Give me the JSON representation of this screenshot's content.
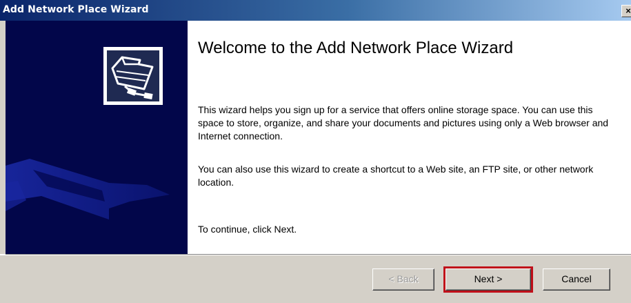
{
  "window": {
    "title": "Add Network Place Wizard",
    "close_label": "×"
  },
  "welcome": {
    "heading": "Welcome to the Add Network Place Wizard",
    "paragraph1": "This wizard helps you sign up for a service that offers online storage space. You can use this space to store, organize, and share your documents and pictures using only a Web browser and Internet connection.",
    "paragraph2": "You can also use this wizard to create a shortcut to a Web site, an FTP site, or other network location.",
    "paragraph3": "To continue, click Next."
  },
  "buttons": {
    "back_label": "< Back",
    "next_label": "Next >",
    "cancel_label": "Cancel"
  },
  "colors": {
    "title_bar_start": "#0a246a",
    "side_panel": "#02064a",
    "dialog_face": "#d4d0c8",
    "highlight_border": "#c0101a"
  },
  "icons": {
    "wizard": "network-folder-icon",
    "close": "close-icon"
  }
}
